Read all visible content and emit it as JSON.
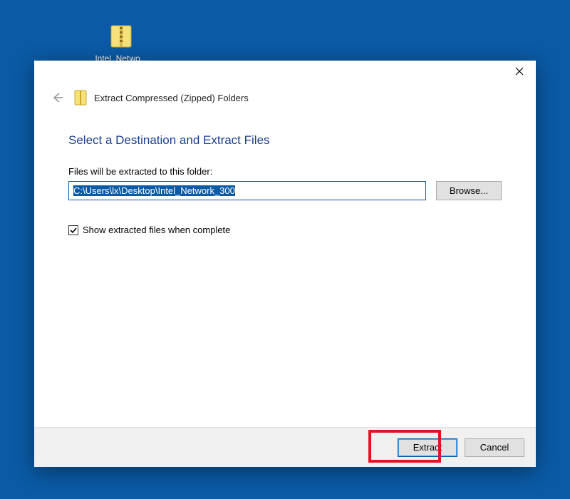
{
  "desktop": {
    "icon_label": "Intel_Netwo..."
  },
  "dialog": {
    "window_title": "Extract Compressed (Zipped) Folders",
    "instruction": "Select a Destination and Extract Files",
    "path_label": "Files will be extracted to this folder:",
    "path_value": "C:\\Users\\lx\\Desktop\\Intel_Network_300",
    "browse_label": "Browse...",
    "checkbox_label": "Show extracted files when complete",
    "checkbox_checked": true,
    "extract_label": "Extract",
    "cancel_label": "Cancel"
  },
  "colors": {
    "desktop_bg": "#0a5aa5",
    "heading_blue": "#1b3f8f",
    "highlight_red": "#e81123"
  }
}
